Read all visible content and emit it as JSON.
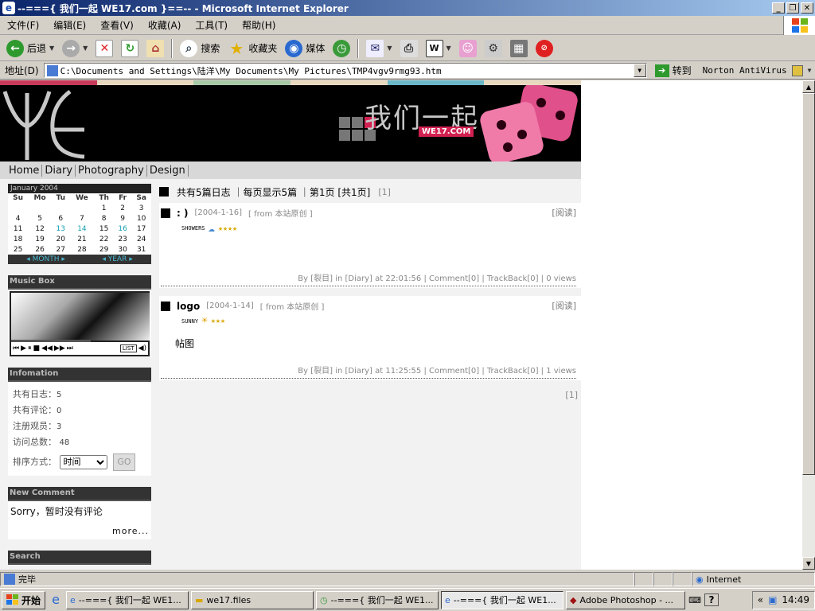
{
  "window": {
    "title": "--==={ 我们一起 WE17.com }==-- - Microsoft Internet Explorer"
  },
  "menu": [
    "文件(F)",
    "编辑(E)",
    "查看(V)",
    "收藏(A)",
    "工具(T)",
    "帮助(H)"
  ],
  "toolbar": {
    "back": "后退",
    "search": "搜索",
    "favorites": "收藏夹",
    "media": "媒体"
  },
  "address": {
    "label": "地址(D)",
    "url": "C:\\Documents and Settings\\陆洋\\My Documents\\My Pictures\\TMP4vgv9rmg93.htm",
    "go": "转到",
    "norton": "Norton AntiVirus"
  },
  "site": {
    "banner_title": "我们一起",
    "banner_url": "WE17.COM",
    "nav": [
      "Home",
      "Diary",
      "Photography",
      "Design"
    ],
    "calendar": {
      "month": "January 2004",
      "days": [
        "Su",
        "Mo",
        "Tu",
        "We",
        "Th",
        "Fr",
        "Sa"
      ],
      "weeks": [
        [
          "",
          "",
          "",
          "",
          "1",
          "2",
          "3"
        ],
        [
          "4",
          "5",
          "6",
          "7",
          "8",
          "9",
          "10"
        ],
        [
          "11",
          "12",
          "13",
          "14",
          "15",
          "16",
          "17"
        ],
        [
          "18",
          "19",
          "20",
          "21",
          "22",
          "23",
          "24"
        ],
        [
          "25",
          "26",
          "27",
          "28",
          "29",
          "30",
          "31"
        ]
      ],
      "linked_days": [
        "13",
        "14",
        "16"
      ],
      "prev_month": "MONTH",
      "prev_year": "YEAR"
    },
    "music_box": {
      "title": "Music Box",
      "list_label": "LIST"
    },
    "info": {
      "title": "Infomation",
      "entries_label": "共有日志：",
      "entries": "5",
      "comments_label": "共有评论：",
      "comments": "0",
      "members_label": "注册观员：",
      "members": "3",
      "visits_label": "访问总数：",
      "visits": "48",
      "sort_label": "排序方式：",
      "sort_value": "时间",
      "go_label": "GO"
    },
    "new_comment": {
      "title": "New Comment",
      "text": "Sorry，暂时没有评论",
      "more": "more..."
    },
    "search": {
      "title": "Search"
    },
    "list_header": "共有5篇日志 ｜每页显示5篇 ｜第1页 [共1页]",
    "pager": "[1]",
    "read_label": "[阅读]",
    "posts": [
      {
        "title": ": )",
        "date": "[2004-1-16]",
        "from": "[ from 本站原创 ]",
        "weather": "SHOWERS",
        "body": "",
        "footer": "By [裂目] in [Diary] at 22:01:56 | Comment[0] | TrackBack[0] | 0 views"
      },
      {
        "title": "logo",
        "date": "[2004-1-14]",
        "from": "[ from 本站原创 ]",
        "weather": "SUNNY",
        "body": "帖图",
        "footer": "By [裂目] in [Diary] at 11:25:55 | Comment[0] | TrackBack[0] | 1 views"
      }
    ],
    "bottom_pager": "[1]"
  },
  "status": {
    "text": "完毕",
    "zone": "Internet"
  },
  "taskbar": {
    "start": "开始",
    "tasks": [
      "--==={ 我们一起 WE1...",
      "we17.files",
      "--==={ 我们一起 WE1...",
      "--==={ 我们一起 WE1...",
      "Adobe Photoshop - ..."
    ],
    "clock": "14:49"
  }
}
